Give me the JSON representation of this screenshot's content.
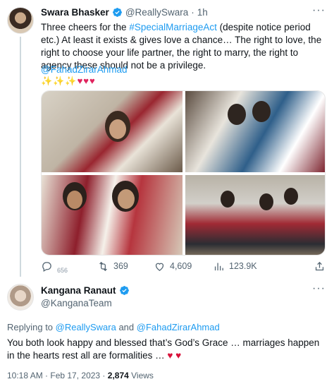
{
  "tweet1": {
    "author_name": "Swara Bhasker",
    "handle": "@ReallySwara",
    "separator": "·",
    "time": "1h",
    "text_part1": "Three cheers for the ",
    "hashtag": "#SpecialMarriageAct",
    "text_part2": " (despite notice period etc.) At least it exists & gives love a chance… The right to love, the right to choose your life partner, the right to marry, the right to agency these should not be a privilege.",
    "mention": "@FahadZirarAhmad",
    "emoji_sparkles": "✨✨✨",
    "emoji_hearts": "♥♥♥",
    "actions": {
      "reply_count": "656",
      "retweet_count": "369",
      "like_count": "4,609",
      "views_count": "123.9K"
    },
    "icons": [
      "verified-badge-icon",
      "more-icon",
      "reply-icon",
      "retweet-icon",
      "like-icon",
      "views-icon",
      "share-icon"
    ]
  },
  "tweet2": {
    "author_name": "Kangana Ranaut",
    "handle": "@KanganaTeam",
    "replying_prefix": "Replying to ",
    "replying_mention1": "@ReallySwara",
    "replying_and": " and ",
    "replying_mention2": "@FahadZirarAhmad",
    "text": "You both look happy and blessed that’s God’s Grace … marriages happen in the hearts rest all are formalities … ",
    "hearts": "♥ ♥",
    "timestamp": "10:18 AM · Feb 17, 2023 · ",
    "views_count": "2,874",
    "views_label": " Views"
  },
  "colors": {
    "link": "#1d9bf0",
    "secondary_text": "#536471",
    "primary_text": "#0f1419",
    "heart": "#d8113a"
  }
}
